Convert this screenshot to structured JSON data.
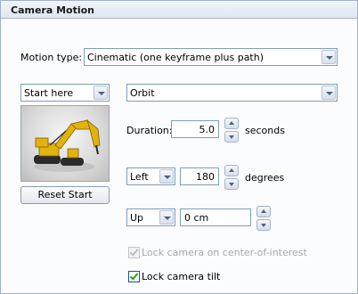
{
  "panel": {
    "title": "Camera Motion"
  },
  "motion_type": {
    "label": "Motion type:",
    "value": "Cinematic (one keyframe plus path)"
  },
  "start": {
    "value": "Start here",
    "reset_label": "Reset Start"
  },
  "path": {
    "value": "Orbit"
  },
  "duration": {
    "label": "Duration:",
    "value": "5.0",
    "unit": "seconds"
  },
  "direction": {
    "value": "Left",
    "angle": "180",
    "unit": "degrees"
  },
  "vertical": {
    "value": "Up",
    "offset": "0 cm"
  },
  "lock_coi": {
    "label": "Lock camera on center-of-interest",
    "checked": true,
    "enabled": false
  },
  "lock_tilt": {
    "label": "Lock camera tilt",
    "checked": true,
    "enabled": true
  },
  "colors": {
    "checkmark": "#21a121",
    "excavator": "#e3b20c"
  }
}
